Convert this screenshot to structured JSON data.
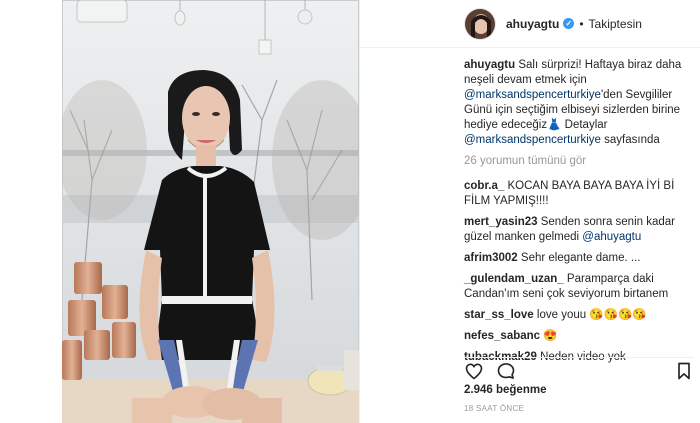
{
  "post": {
    "username": "ahuyagtu",
    "verified_icon": "verified-badge-icon",
    "follow_status": "Takiptesin",
    "caption": {
      "user": "ahuyagtu",
      "part1": "Salı sürprizi! Haftaya biraz daha neşeli devam etmek için",
      "mention1": "@marksandspencerturkiye",
      "part2": "'den Sevgililer Günü için seçtiğim elbiseyi sizlerden birine hediye edeceğiz",
      "emoji": "👗",
      "part3": " Detaylar",
      "mention2": "@marksandspencerturkiye",
      "part4": " sayfasında"
    },
    "view_all": "26 yorumun tümünü gör",
    "comments": [
      {
        "user": "cobr.a_",
        "text": "KOCAN BAYA BAYA BAYA İYİ Bİ FİLM YAPMIŞ!!!!"
      },
      {
        "user": "mert_yasin23",
        "text": "Senden sonra senin kadar güzel manken gelmedi ",
        "mention": "@ahuyagtu"
      },
      {
        "user": "afrim3002",
        "text": "Sehr elegante dame. ..."
      },
      {
        "user": "_gulendam_uzan_",
        "text": "Paramparça daki Candan'ım seni çok seviyorum birtanem"
      },
      {
        "user": "star_ss_love",
        "text": "love youu 😘😘😘😘"
      },
      {
        "user": "nefes_sabanc",
        "text": "😍"
      },
      {
        "user": "tubackmak29",
        "text": "Neden video yok"
      }
    ],
    "likes": "2.946 beğenme",
    "timestamp": "18 SAAT ÖNCE"
  },
  "icons": {
    "like": "heart-icon",
    "comment": "comment-bubble-icon",
    "save": "bookmark-icon"
  },
  "colors": {
    "mention": "#003569",
    "muted": "#999999",
    "verified": "#3897f0",
    "text": "#262626"
  }
}
